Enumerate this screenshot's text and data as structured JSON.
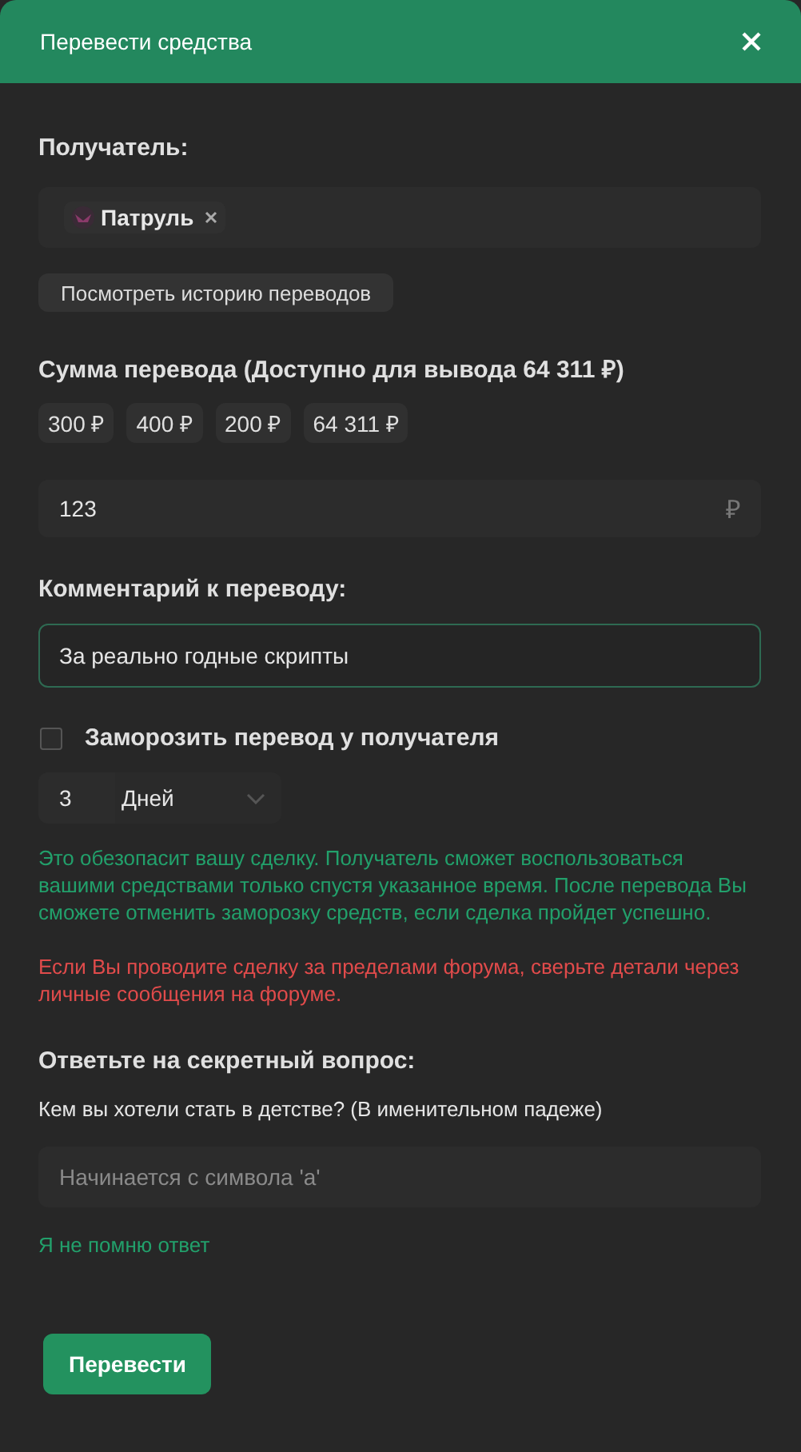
{
  "window": {
    "title": "Перевести средства"
  },
  "recipient": {
    "label": "Получатель:",
    "name": "Патруль",
    "history_button": "Посмотреть историю переводов"
  },
  "amount": {
    "label": "Сумма перевода (Доступно для вывода 64 311 ₽)",
    "presets": [
      "300 ₽",
      "400 ₽",
      "200 ₽",
      "64 311 ₽"
    ],
    "value": "123",
    "currency": "₽"
  },
  "comment": {
    "label": "Комментарий к переводу:",
    "value": "За реально годные скрипты"
  },
  "freeze": {
    "label": "Заморозить перевод у получателя",
    "checked": false,
    "count": "3",
    "unit": "Дней",
    "info": "Это обезопасит вашу сделку. Получатель сможет воспользоваться вашими средствами только спустя указанное время. После перевода Вы сможете отменить заморозку средств, если сделка пройдет успешно.",
    "warning": "Если Вы проводите сделку за пределами форума, сверьте детали через личные сообщения на форуме."
  },
  "secret": {
    "label": "Ответьте на секретный вопрос:",
    "question": "Кем вы хотели стать в детстве? (В именительном падеже)",
    "placeholder": "Начинается с символа 'а'",
    "forgot_link": "Я не помню ответ"
  },
  "submit_button": "Перевести"
}
